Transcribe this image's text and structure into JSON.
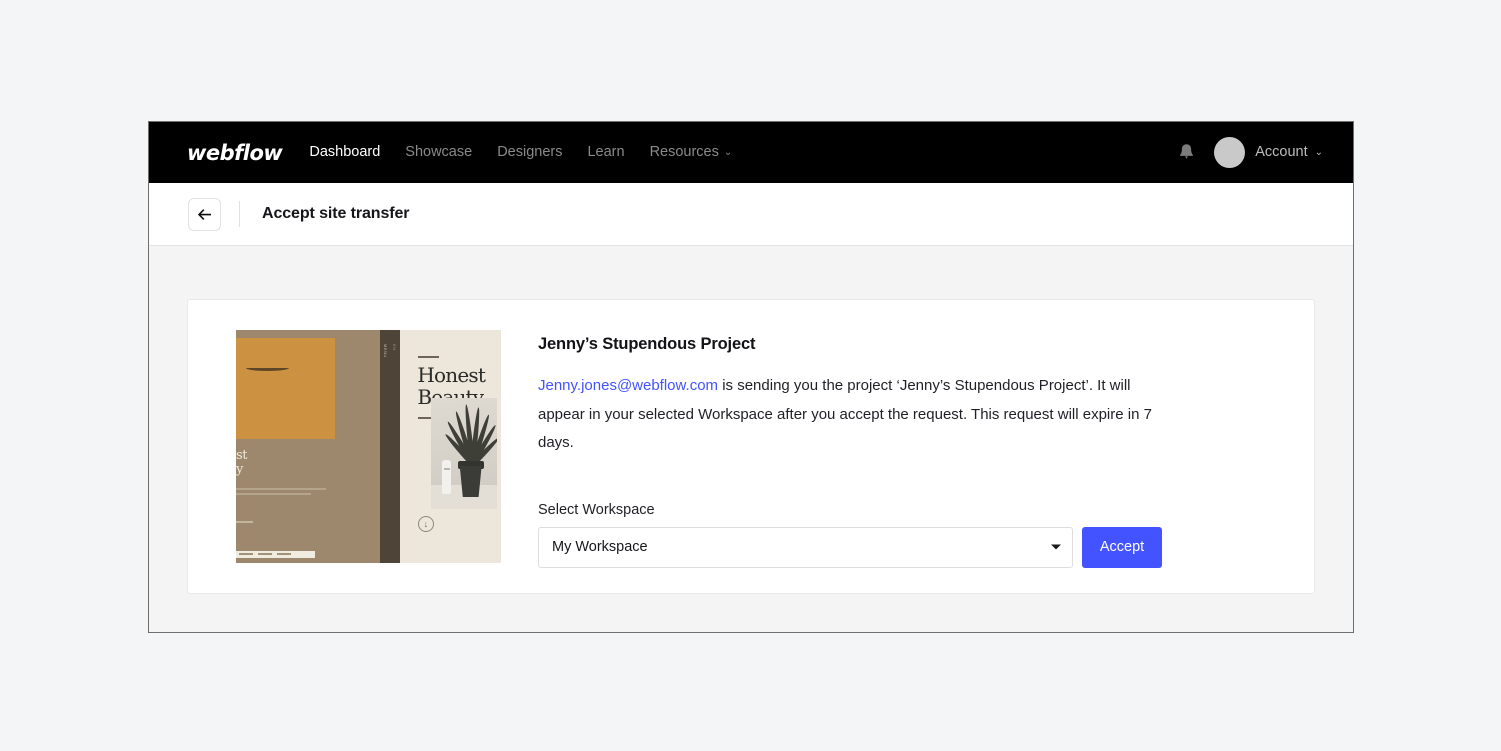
{
  "navbar": {
    "logo": "webflow",
    "links": [
      {
        "label": "Dashboard",
        "active": true,
        "caret": ""
      },
      {
        "label": "Showcase",
        "active": false,
        "caret": ""
      },
      {
        "label": "Designers",
        "active": false,
        "caret": ""
      },
      {
        "label": "Learn",
        "active": false,
        "caret": ""
      },
      {
        "label": "Resources",
        "active": false,
        "caret": "⌄"
      }
    ],
    "notifications_icon": "bell-icon",
    "account_label": "Account",
    "account_caret": "⌄"
  },
  "subheader": {
    "back_icon": "arrow-left-icon",
    "title": "Accept site transfer"
  },
  "card": {
    "thumbnail": {
      "site_heading_line1": "Honest",
      "site_heading_line2": "Beauty",
      "left_heading_line1": "st",
      "left_heading_line2": "y",
      "strip_label_one": "MENU",
      "strip_label_two": "EN",
      "download_glyph": "↓"
    },
    "project_title": "Jenny’s Stupendous Project",
    "sender_email": "Jenny.jones@webflow.com",
    "description_rest": " is sending you the project ‘Jenny’s Stupendous Project’. It will appear in your selected Workspace after you accept the request. This request will expire in 7 days.",
    "workspace_label": "Select Workspace",
    "workspace_selected": "My Workspace",
    "workspace_options": [
      "My Workspace"
    ],
    "accept_label": "Accept"
  },
  "colors": {
    "accent": "#4353ff",
    "navbar_bg": "#000000",
    "page_bg": "#f4f4f5",
    "card_bg": "#ffffff"
  }
}
